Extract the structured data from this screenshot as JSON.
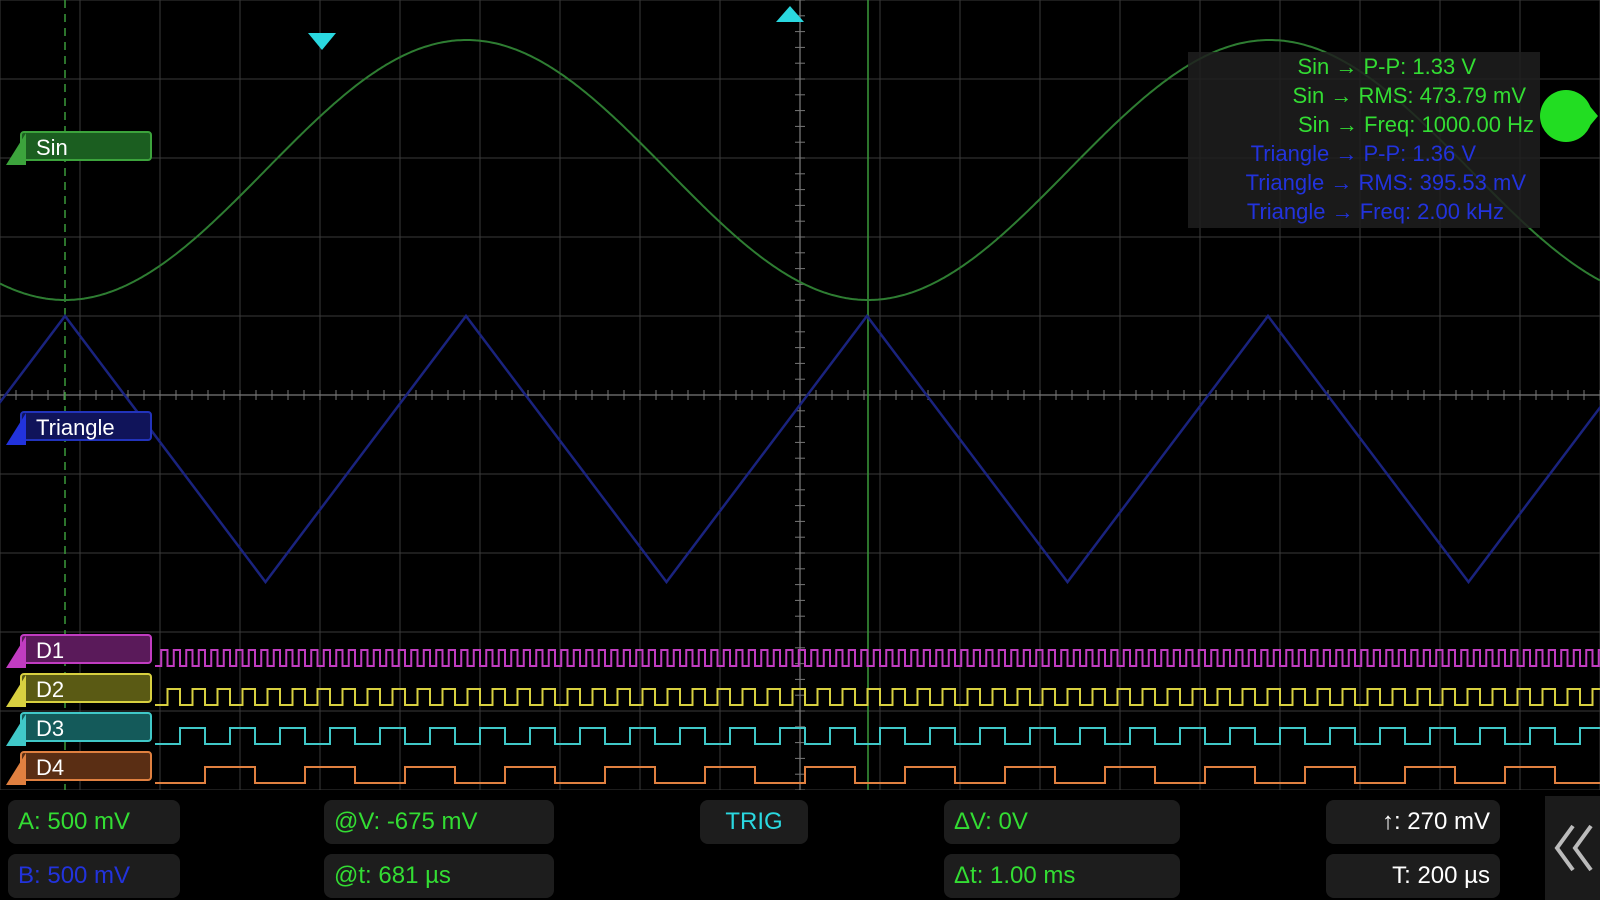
{
  "channels": {
    "sin": {
      "label": "Sin",
      "color": "#2e7d32",
      "label_color": "#1b5e20"
    },
    "triangle": {
      "label": "Triangle",
      "color": "#1a237e",
      "label_color": "#10145a"
    },
    "d1": {
      "label": "D1",
      "color": "#c13cc1"
    },
    "d2": {
      "label": "D2",
      "color": "#d8d040"
    },
    "d3": {
      "label": "D3",
      "color": "#40c8c8"
    },
    "d4": {
      "label": "D4",
      "color": "#e08040"
    }
  },
  "measurements": [
    {
      "text": "Sin → P-P: 1.33 V",
      "color": "#33dd33"
    },
    {
      "text": "Sin → RMS: 473.79 mV",
      "color": "#33dd33"
    },
    {
      "text": "Sin → Freq: 1000.00 Hz",
      "color": "#33dd33"
    },
    {
      "text": "Triangle → P-P: 1.36 V",
      "color": "#2233dd"
    },
    {
      "text": "Triangle → RMS: 395.53 mV",
      "color": "#2233dd"
    },
    {
      "text": "Triangle → Freq: 2.00 kHz",
      "color": "#2233dd"
    }
  ],
  "bottom": {
    "a_scale": "A: 500 mV",
    "b_scale": "B: 500 mV",
    "at_v": "@V: -675 mV",
    "at_t": "@t: 681 µs",
    "trig": "TRIG",
    "delta_v": "ΔV: 0V",
    "delta_t": "Δt: 1.00 ms",
    "trig_level": "↑: 270 mV",
    "timebase": "T: 200 µs"
  },
  "icons": {
    "run_indicator": "green-run-dot-icon",
    "collapse": "double-chevron-left-icon",
    "cursor_marker_1": "cyan-down-triangle-icon",
    "cursor_marker_2": "cyan-up-marker-icon"
  },
  "colors": {
    "grid": "#3a3a3a",
    "cursor_cyan": "#2ad8e0",
    "cursor_green": "#3a9a3a",
    "trig_text": "#2ad8e0",
    "a_text": "#33dd33",
    "b_text": "#2233dd"
  }
}
